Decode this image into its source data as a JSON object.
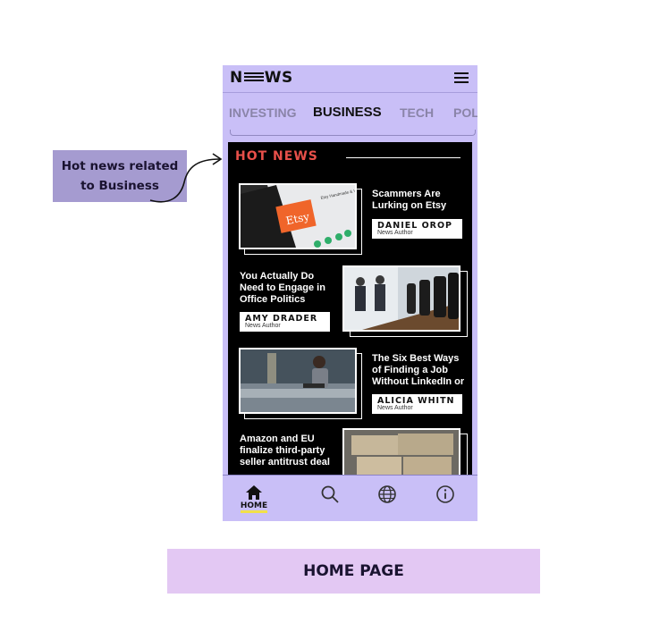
{
  "annotation": {
    "line1": "Hot news related",
    "line2": "to Business"
  },
  "header": {
    "logo_left": "N",
    "logo_right": "WS",
    "menu_icon": "hamburger-menu-icon"
  },
  "tabs": [
    {
      "label": "INVESTING"
    },
    {
      "label": "BUSINESS",
      "active": true
    },
    {
      "label": "TECH"
    },
    {
      "label": "POL"
    }
  ],
  "hot_news": {
    "title": "HOT NEWS",
    "title_color": "#e8504a",
    "articles": [
      {
        "headline": "Scammers Are Lurking on Etsy",
        "author": "DANIEL OROP",
        "role": "News Author",
        "image_text": "Etsy",
        "image_caption": "Etsy Handmade & Vintage Goods"
      },
      {
        "headline": "You Actually Do Need to Engage in Office Politics",
        "author": "AMY DRADER",
        "role": "News Author"
      },
      {
        "headline": "The Six Best Ways of Finding a Job Without LinkedIn or",
        "author": "ALICIA WHITN",
        "role": "News Author"
      },
      {
        "headline": "Amazon and EU finalize third-party seller antitrust deal"
      }
    ]
  },
  "bottom_nav": [
    {
      "icon": "home-icon",
      "label": "HOME",
      "active": true
    },
    {
      "icon": "search-icon"
    },
    {
      "icon": "globe-icon"
    },
    {
      "icon": "info-icon"
    }
  ],
  "caption": "HOME PAGE",
  "colors": {
    "phone_bg": "#c9bff7",
    "annotation_bg": "#a59bd0",
    "caption_bg": "#e3c8f3",
    "feed_bg": "#000000",
    "home_underline": "#f1e04a"
  }
}
